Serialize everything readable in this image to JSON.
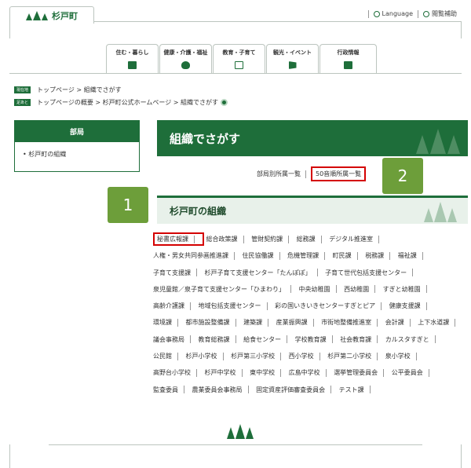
{
  "header": {
    "logo": "杉戸町",
    "language": "Language",
    "accessibility": "閲覧補助"
  },
  "gnav": [
    {
      "label": "住む・暮らし",
      "icon": "house-icon"
    },
    {
      "label": "健康・介護・福祉",
      "icon": "heart-hand-icon"
    },
    {
      "label": "教育・子育て",
      "icon": "notebook-icon"
    },
    {
      "label": "観光・イベント",
      "icon": "flag-icon"
    },
    {
      "label": "行政情報",
      "icon": "building-icon"
    }
  ],
  "breadcrumb": {
    "current_tag": "現在地",
    "current": "トップページ > 組織でさがす",
    "path_tag": "足あと",
    "path": "トップページの概要 > 杉戸町公式ホームページ > 組織でさがす"
  },
  "sidebar": {
    "title": "部局",
    "item": "杉戸町の組織"
  },
  "main": {
    "title": "組織でさがす",
    "tab_department": "部局別所属一覧",
    "tab_syllabary": "50音順所属一覧",
    "section_title": "杉戸町の組織"
  },
  "badges": {
    "one": "1",
    "two": "2"
  },
  "orgs": [
    "秘書広報課",
    "総合政策課",
    "管財契約課",
    "総務課",
    "デジタル推進室",
    "人権・男女共同参画推進課",
    "住民協働課",
    "危機管理課",
    "町民課",
    "税務課",
    "福祉課",
    "子育て支援課",
    "杉戸子育て支援センター「たんぽぽ」",
    "子育て世代包括支援センター",
    "泉児童館／泉子育て支援センター「ひまわり」",
    "中央幼稚園",
    "西幼稚園",
    "すぎと幼稚園",
    "高齢介護課",
    "地域包括支援センター",
    "彩の国いきいきセンターすぎとピア",
    "健康支援課",
    "環境課",
    "都市施設整備課",
    "建築課",
    "産業振興課",
    "市街地整備推進室",
    "会計課",
    "上下水道課",
    "議会事務局",
    "教育総務課",
    "給食センター",
    "学校教育課",
    "社会教育課",
    "カルスタすぎと",
    "公民館",
    "杉戸小学校",
    "杉戸第三小学校",
    "西小学校",
    "杉戸第二小学校",
    "泉小学校",
    "高野台小学校",
    "杉戸中学校",
    "東中学校",
    "広島中学校",
    "選挙管理委員会",
    "公平委員会",
    "監査委員",
    "農業委員会事務局",
    "固定資産評価審査委員会",
    "テスト課"
  ]
}
